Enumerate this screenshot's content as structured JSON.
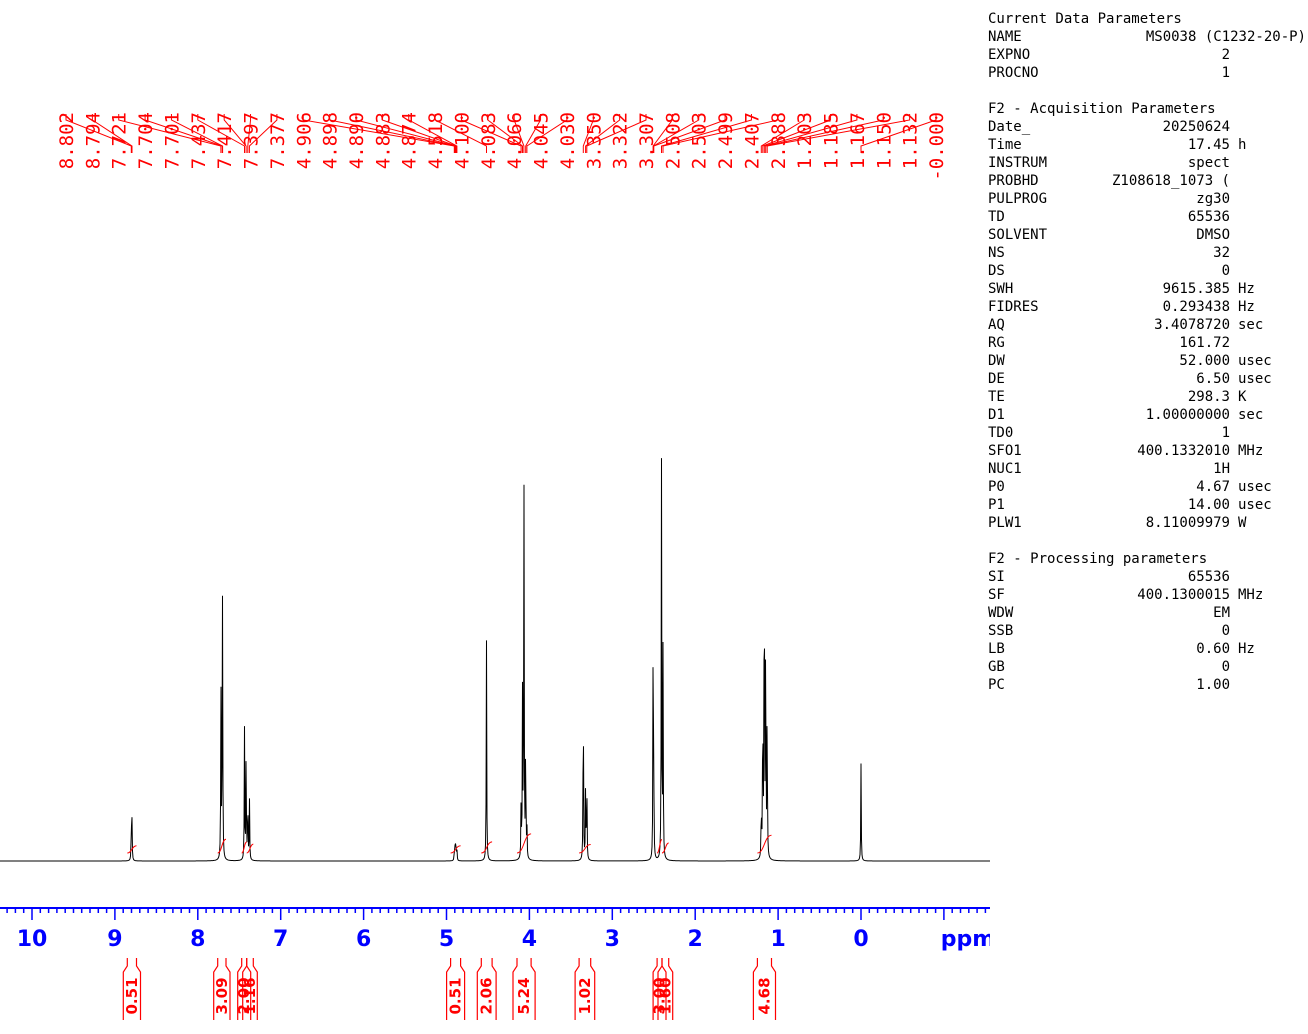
{
  "chart_data": {
    "type": "line",
    "title": "",
    "xlabel": "ppm",
    "xlim": [
      10.4,
      -1.65
    ],
    "x_ticks": [
      "10",
      "9",
      "8",
      "7",
      "6",
      "5",
      "4",
      "3",
      "2",
      "1",
      "0"
    ],
    "peak_labels": [
      "8.802",
      "8.794",
      "7.721",
      "7.704",
      "7.701",
      "7.437",
      "7.417",
      "7.397",
      "7.377",
      "4.906",
      "4.898",
      "4.890",
      "4.883",
      "4.874",
      "4.518",
      "4.100",
      "4.083",
      "4.066",
      "4.045",
      "4.030",
      "3.350",
      "3.322",
      "3.307",
      "2.508",
      "2.503",
      "2.499",
      "2.407",
      "2.388",
      "1.203",
      "1.185",
      "1.167",
      "1.150",
      "1.132",
      "-0.000"
    ],
    "peaks": [
      {
        "x": 8.802,
        "h": 0.1
      },
      {
        "x": 8.794,
        "h": 0.1
      },
      {
        "x": 7.721,
        "h": 0.45
      },
      {
        "x": 7.704,
        "h": 0.42
      },
      {
        "x": 7.701,
        "h": 0.4
      },
      {
        "x": 7.437,
        "h": 0.34
      },
      {
        "x": 7.417,
        "h": 0.3
      },
      {
        "x": 7.397,
        "h": 0.17
      },
      {
        "x": 7.377,
        "h": 0.16
      },
      {
        "x": 4.906,
        "h": 0.025
      },
      {
        "x": 4.898,
        "h": 0.03
      },
      {
        "x": 4.89,
        "h": 0.04
      },
      {
        "x": 4.883,
        "h": 0.03
      },
      {
        "x": 4.874,
        "h": 0.025
      },
      {
        "x": 4.518,
        "h": 0.58
      },
      {
        "x": 4.1,
        "h": 0.15
      },
      {
        "x": 4.083,
        "h": 0.42
      },
      {
        "x": 4.066,
        "h": 1.01
      },
      {
        "x": 4.045,
        "h": 0.32
      },
      {
        "x": 4.03,
        "h": 0.08
      },
      {
        "x": 3.35,
        "h": 0.48
      },
      {
        "x": 3.322,
        "h": 0.2
      },
      {
        "x": 3.307,
        "h": 0.2
      },
      {
        "x": 2.508,
        "h": 0.5
      },
      {
        "x": 2.503,
        "h": 0.15
      },
      {
        "x": 2.499,
        "h": 0.12
      },
      {
        "x": 2.407,
        "h": 1.04
      },
      {
        "x": 2.388,
        "h": 0.54
      },
      {
        "x": 1.203,
        "h": 0.14
      },
      {
        "x": 1.185,
        "h": 0.45
      },
      {
        "x": 1.167,
        "h": 0.92
      },
      {
        "x": 1.15,
        "h": 0.64
      },
      {
        "x": 1.132,
        "h": 0.42
      },
      {
        "x": 0.0,
        "h": 0.25
      }
    ],
    "integrals": [
      {
        "x1": 8.85,
        "x2": 8.74,
        "value": "0.51"
      },
      {
        "x1": 7.76,
        "x2": 7.66,
        "value": "3.09"
      },
      {
        "x1": 7.47,
        "x2": 7.41,
        "value": "2.00"
      },
      {
        "x1": 7.41,
        "x2": 7.33,
        "value": "1.16"
      },
      {
        "x1": 4.95,
        "x2": 4.83,
        "value": "0.51"
      },
      {
        "x1": 4.58,
        "x2": 4.45,
        "value": "2.06"
      },
      {
        "x1": 4.15,
        "x2": 3.98,
        "value": "5.24"
      },
      {
        "x1": 3.4,
        "x2": 3.26,
        "value": "1.02"
      },
      {
        "x1": 2.46,
        "x2": 2.4,
        "value": "3.00"
      },
      {
        "x1": 2.4,
        "x2": 2.32,
        "value": "1.60"
      },
      {
        "x1": 1.25,
        "x2": 1.08,
        "value": "4.68"
      }
    ],
    "colors": {
      "spectrum": "#000000",
      "labels": "#ff0000",
      "axis": "#0000ff"
    }
  },
  "params": {
    "current": {
      "title": "Current Data Parameters",
      "rows": [
        {
          "key": "NAME",
          "value": "MS0038 (C1232-20-P)",
          "unit": ""
        },
        {
          "key": "EXPNO",
          "value": "2",
          "unit": ""
        },
        {
          "key": "PROCNO",
          "value": "1",
          "unit": ""
        }
      ]
    },
    "acquisition": {
      "title": "F2 - Acquisition Parameters",
      "rows": [
        {
          "key": "Date_",
          "value": "20250624",
          "unit": ""
        },
        {
          "key": "Time",
          "value": "17.45",
          "unit": "h"
        },
        {
          "key": "INSTRUM",
          "value": "spect",
          "unit": ""
        },
        {
          "key": "PROBHD",
          "value": "Z108618_1073 (",
          "unit": ""
        },
        {
          "key": "PULPROG",
          "value": "zg30",
          "unit": ""
        },
        {
          "key": "TD",
          "value": "65536",
          "unit": ""
        },
        {
          "key": "SOLVENT",
          "value": "DMSO",
          "unit": ""
        },
        {
          "key": "NS",
          "value": "32",
          "unit": ""
        },
        {
          "key": "DS",
          "value": "0",
          "unit": ""
        },
        {
          "key": "SWH",
          "value": "9615.385",
          "unit": "Hz"
        },
        {
          "key": "FIDRES",
          "value": "0.293438",
          "unit": "Hz"
        },
        {
          "key": "AQ",
          "value": "3.4078720",
          "unit": "sec"
        },
        {
          "key": "RG",
          "value": "161.72",
          "unit": ""
        },
        {
          "key": "DW",
          "value": "52.000",
          "unit": "usec"
        },
        {
          "key": "DE",
          "value": "6.50",
          "unit": "usec"
        },
        {
          "key": "TE",
          "value": "298.3",
          "unit": "K"
        },
        {
          "key": "D1",
          "value": "1.00000000",
          "unit": "sec"
        },
        {
          "key": "TD0",
          "value": "1",
          "unit": ""
        },
        {
          "key": "SFO1",
          "value": "400.1332010",
          "unit": "MHz"
        },
        {
          "key": "NUC1",
          "value": "1H",
          "unit": ""
        },
        {
          "key": "P0",
          "value": "4.67",
          "unit": "usec"
        },
        {
          "key": "P1",
          "value": "14.00",
          "unit": "usec"
        },
        {
          "key": "PLW1",
          "value": "8.11009979",
          "unit": "W"
        }
      ]
    },
    "processing": {
      "title": "F2 - Processing parameters",
      "rows": [
        {
          "key": "SI",
          "value": "65536",
          "unit": ""
        },
        {
          "key": "SF",
          "value": "400.1300015",
          "unit": "MHz"
        },
        {
          "key": "WDW",
          "value": "EM",
          "unit": ""
        },
        {
          "key": "SSB",
          "value": "0",
          "unit": ""
        },
        {
          "key": "LB",
          "value": "0.60",
          "unit": "Hz"
        },
        {
          "key": "GB",
          "value": "0",
          "unit": ""
        },
        {
          "key": "PC",
          "value": "1.00",
          "unit": ""
        }
      ]
    }
  }
}
